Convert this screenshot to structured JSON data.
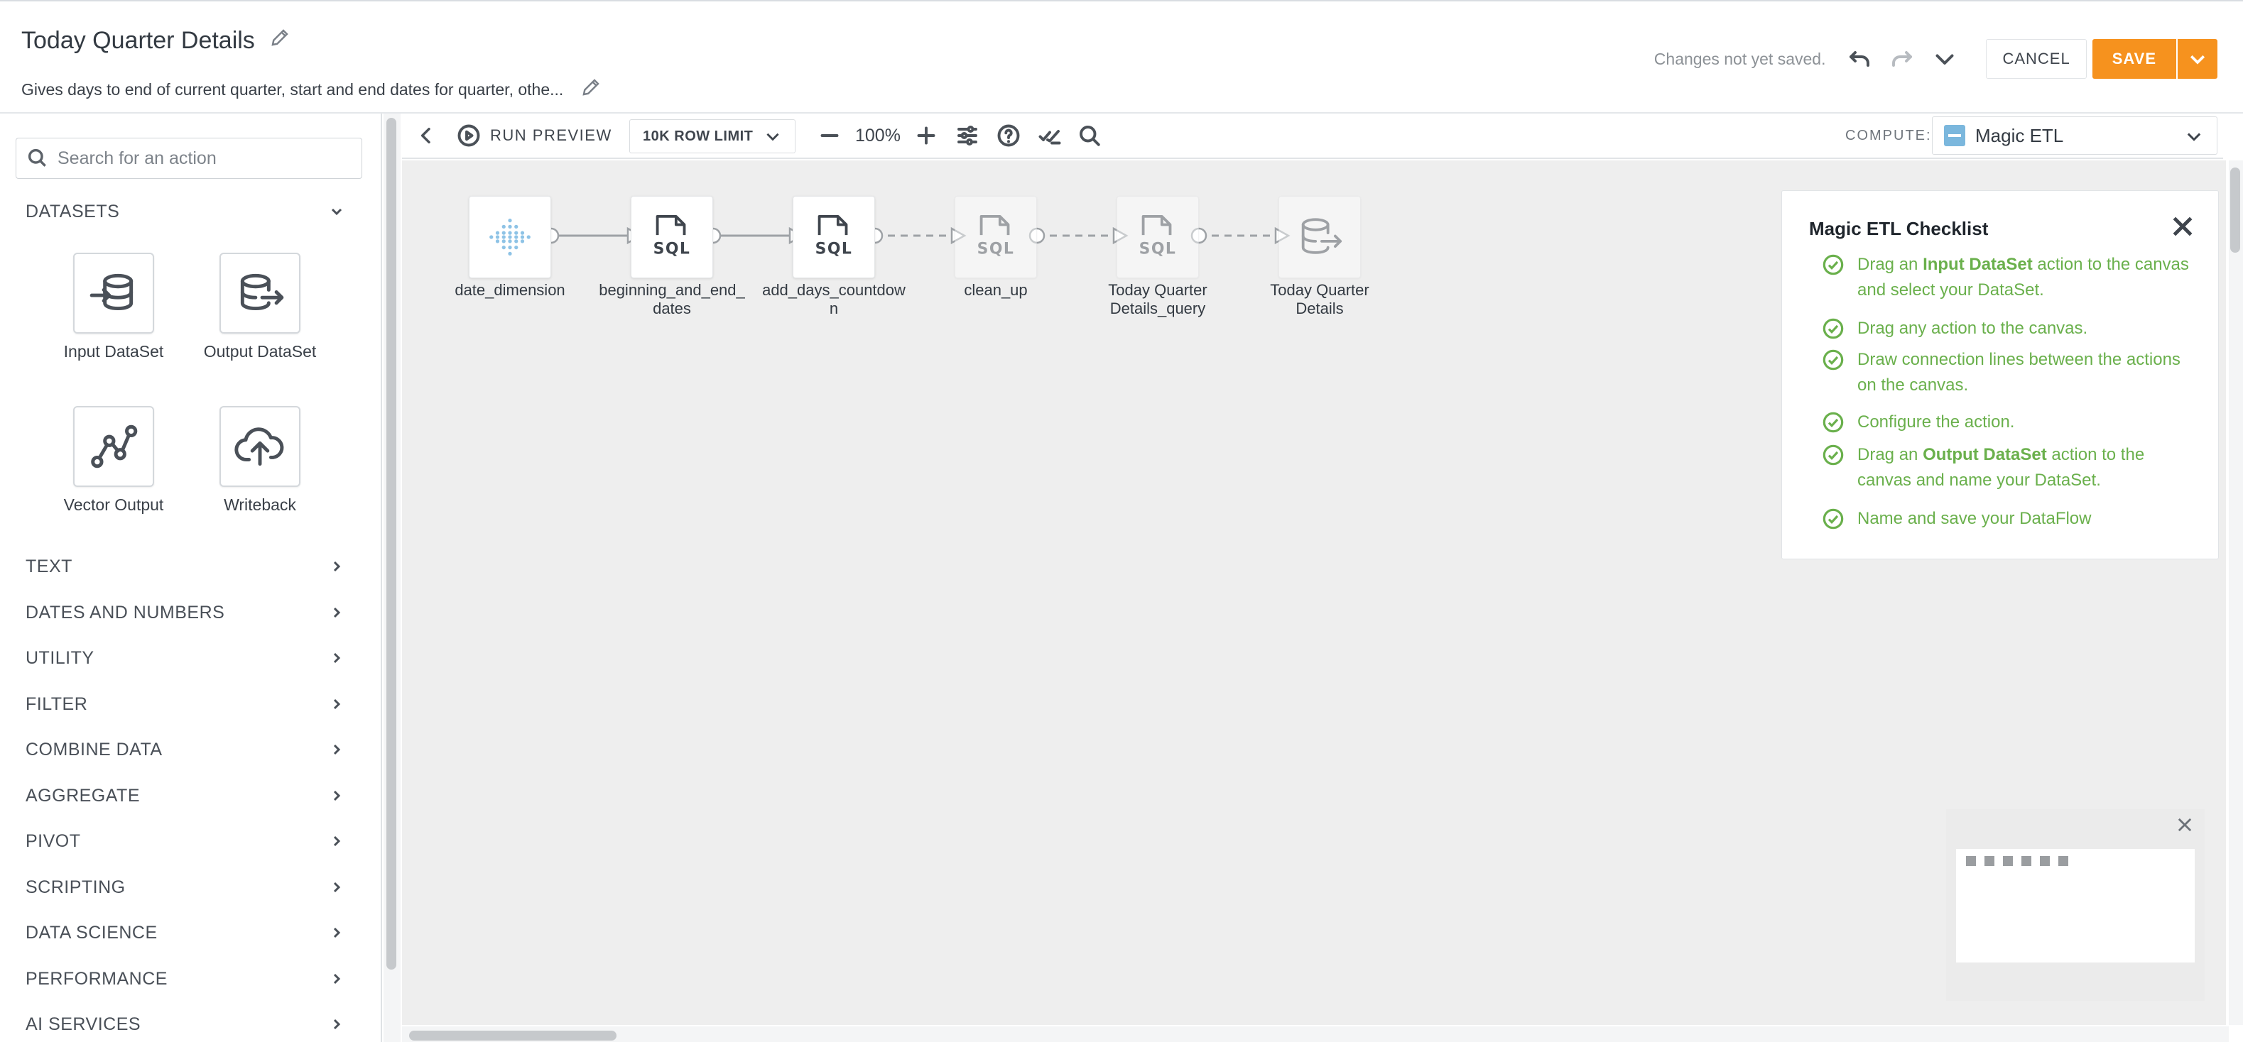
{
  "header": {
    "title": "Today Quarter Details",
    "description": "Gives days to end of current quarter, start and end dates for quarter, othe...",
    "status": "Changes not yet saved.",
    "cancel_label": "CANCEL",
    "save_label": "SAVE"
  },
  "sidebar": {
    "search_placeholder": "Search for an action",
    "datasets_label": "DATASETS",
    "tiles": [
      {
        "label": "Input DataSet",
        "icon": "database-input-icon"
      },
      {
        "label": "Output DataSet",
        "icon": "database-output-icon"
      },
      {
        "label": "Vector Output",
        "icon": "vector-nodes-icon"
      },
      {
        "label": "Writeback",
        "icon": "cloud-upload-icon"
      }
    ],
    "categories": [
      "TEXT",
      "DATES AND NUMBERS",
      "UTILITY",
      "FILTER",
      "COMBINE DATA",
      "AGGREGATE",
      "PIVOT",
      "SCRIPTING",
      "DATA SCIENCE",
      "PERFORMANCE",
      "AI SERVICES"
    ]
  },
  "toolbar": {
    "run_preview_label": "RUN PREVIEW",
    "row_limit": "10K ROW LIMIT",
    "zoom": "100%",
    "compute_label": "COMPUTE:",
    "compute_value": "Magic ETL"
  },
  "canvas": {
    "nodes": [
      {
        "label": "date_dimension",
        "icon": "input-dataset-dots-icon"
      },
      {
        "label": "beginning_and_end_dates",
        "icon": "sql-file-icon"
      },
      {
        "label": "add_days_countdown",
        "icon": "sql-file-icon"
      },
      {
        "label": "clean_up",
        "icon": "sql-file-icon"
      },
      {
        "label": "Today Quarter Details_query",
        "icon": "sql-file-icon"
      },
      {
        "label": "Today Quarter Details",
        "icon": "output-dataset-icon"
      }
    ]
  },
  "checklist": {
    "title": "Magic ETL Checklist",
    "items": [
      {
        "pre": "Drag an ",
        "bold": "Input DataSet",
        "post": " action to the canvas and select your DataSet."
      },
      {
        "pre": "Drag any action to the canvas.",
        "bold": "",
        "post": ""
      },
      {
        "pre": "Draw connection lines between the actions on the canvas.",
        "bold": "",
        "post": ""
      },
      {
        "pre": "Configure the action.",
        "bold": "",
        "post": ""
      },
      {
        "pre": "Drag an ",
        "bold": "Output DataSet",
        "post": " action to the canvas and name your DataSet."
      },
      {
        "pre": "Name and save your DataFlow",
        "bold": "",
        "post": ""
      }
    ]
  },
  "colors": {
    "accent": "#f6921e",
    "check_green": "#6ab04c",
    "canvas_bg": "#eeeeee"
  }
}
